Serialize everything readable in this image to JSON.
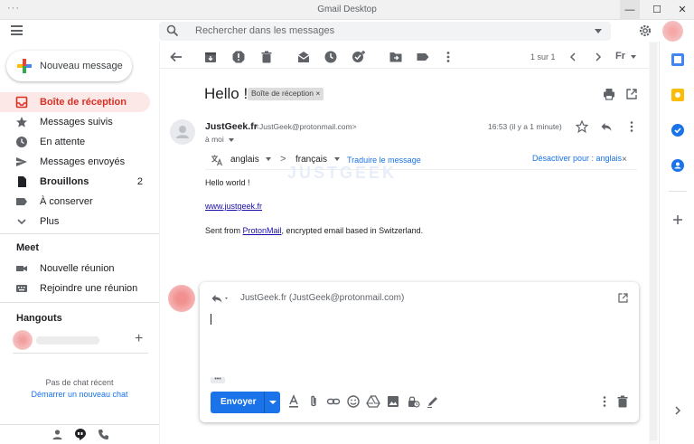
{
  "window": {
    "title": "Gmail Desktop",
    "menu_dots": "···",
    "min": "—",
    "max": "☐",
    "close": "✕"
  },
  "search": {
    "placeholder": "Rechercher dans les messages"
  },
  "compose": {
    "label": "Nouveau message"
  },
  "nav": {
    "items": [
      {
        "label": "Boîte de réception",
        "icon": "inbox-icon",
        "active": true
      },
      {
        "label": "Messages suivis",
        "icon": "star-icon"
      },
      {
        "label": "En attente",
        "icon": "clock-icon"
      },
      {
        "label": "Messages envoyés",
        "icon": "send-icon"
      },
      {
        "label": "Brouillons",
        "icon": "draft-icon",
        "count": "2"
      },
      {
        "label": "À conserver",
        "icon": "label-icon"
      },
      {
        "label": "Plus",
        "icon": "chevron-down-icon"
      }
    ]
  },
  "meet": {
    "title": "Meet",
    "new_meeting": "Nouvelle réunion",
    "join_meeting": "Rejoindre une réunion"
  },
  "hangouts": {
    "title": "Hangouts",
    "no_chat": "Pas de chat récent",
    "start_chat": "Démarrer un nouveau chat",
    "add": "+"
  },
  "toolbar": {
    "pager": "1 sur 1",
    "lang": "Fr"
  },
  "message": {
    "subject": "Hello !",
    "label": "Boîte de réception",
    "label_close": "×",
    "sender_name": "JustGeek.fr",
    "sender_email": "<JustGeek@protonmail.com>",
    "to": "à moi",
    "time": "16:53 (il y a 1 minute)",
    "translate": {
      "source": "anglais",
      "arrow": ">",
      "target": "français",
      "link": "Traduire le message",
      "disable": "Désactiver pour : anglais",
      "close": "×"
    },
    "watermark": "JUSTGEEK",
    "body_hello": "Hello world !",
    "body_link": "www.justgeek.fr",
    "body_sent_prefix": "Sent from ",
    "body_sent_link": "ProtonMail",
    "body_sent_suffix": ", encrypted email based in Switzerland."
  },
  "reply": {
    "to": "JustGeek.fr (JustGeek@protonmail.com)",
    "dots": "•••",
    "send_label": "Envoyer"
  },
  "colors": {
    "accent_red": "#d93025",
    "accent_blue": "#1a73e8",
    "active_bg": "#fce8e6"
  }
}
